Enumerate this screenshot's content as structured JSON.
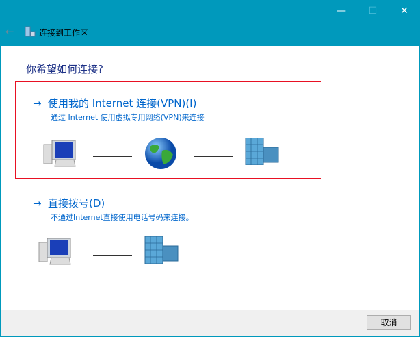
{
  "window": {
    "title": "连接到工作区",
    "minimize": "—",
    "maximize": "☐",
    "close": "✕",
    "back": "←"
  },
  "heading": "你希望如何连接?",
  "options": [
    {
      "title": "使用我的 Internet 连接(VPN)(I)",
      "description": "通过 Internet 使用虚拟专用网络(VPN)来连接",
      "arrow": "→",
      "selected": true
    },
    {
      "title": "直接拨号(D)",
      "description": "不通过Internet直接使用电话号码来连接。",
      "arrow": "→",
      "selected": false
    }
  ],
  "footer": {
    "cancel": "取消"
  },
  "colors": {
    "titlebar": "#0099bc",
    "link": "#0066cc",
    "selection_border": "#e81123"
  }
}
